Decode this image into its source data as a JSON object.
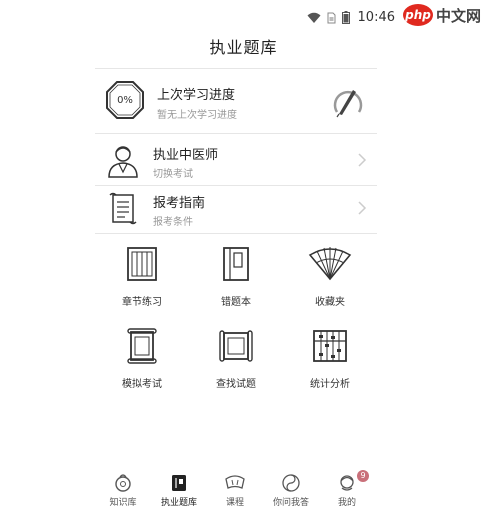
{
  "status_bar": {
    "time": "10:46",
    "icons": [
      "wifi-icon",
      "sim-icon",
      "battery-icon"
    ]
  },
  "watermark": {
    "logo_text": "php",
    "site_text": "中文网"
  },
  "header": {
    "title": "执业题库"
  },
  "progress_card": {
    "percent_text": "0%",
    "title": "上次学习进度",
    "subtitle": "暂无上次学习进度"
  },
  "list_rows": [
    {
      "title": "执业中医师",
      "subtitle": "切换考试",
      "icon": "doctor-icon"
    },
    {
      "title": "报考指南",
      "subtitle": "报考条件",
      "icon": "guide-scroll-icon"
    }
  ],
  "grid_items": [
    {
      "label": "章节练习",
      "icon": "book-chapter-icon"
    },
    {
      "label": "错题本",
      "icon": "notebook-icon"
    },
    {
      "label": "收藏夹",
      "icon": "fan-icon"
    },
    {
      "label": "模拟考试",
      "icon": "scroll-exam-icon"
    },
    {
      "label": "查找试题",
      "icon": "scroll-search-icon"
    },
    {
      "label": "统计分析",
      "icon": "abacus-icon"
    }
  ],
  "tabbar": {
    "items": [
      {
        "label": "知识库",
        "icon": "knowledge-icon"
      },
      {
        "label": "执业题库",
        "icon": "question-bank-icon",
        "active": true
      },
      {
        "label": "课程",
        "icon": "course-icon"
      },
      {
        "label": "你问我答",
        "icon": "qa-icon"
      },
      {
        "label": "我的",
        "icon": "profile-icon",
        "badge": "9"
      }
    ]
  },
  "colors": {
    "accent_badge": "#c9707a",
    "watermark_red": "#e0291f",
    "divider": "#e6e6e6"
  }
}
